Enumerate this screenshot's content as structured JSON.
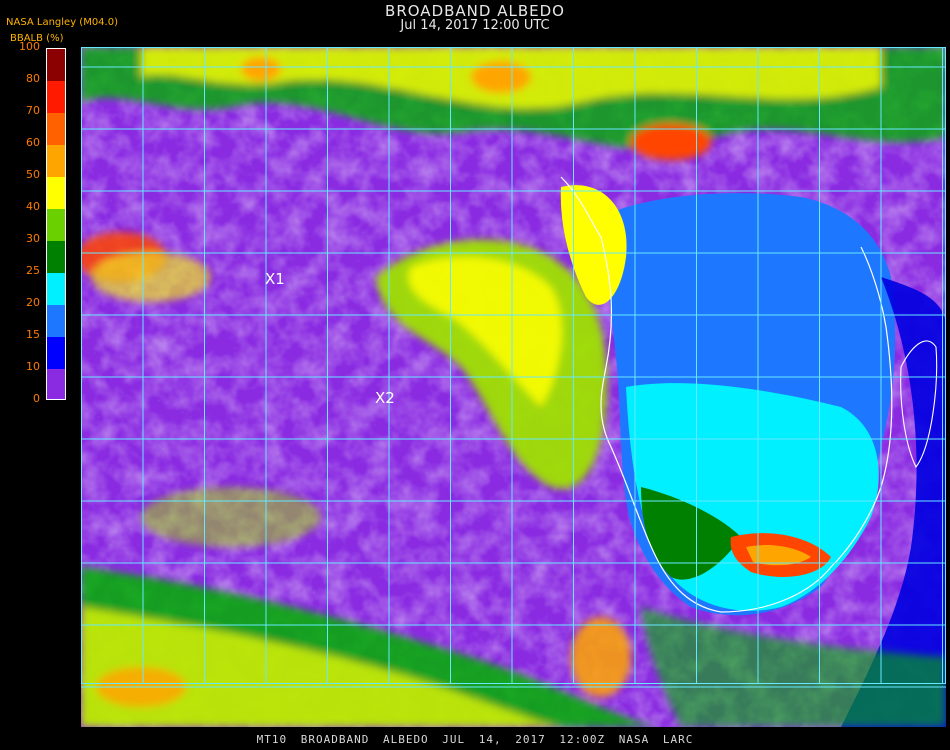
{
  "header": {
    "title": "BROADBAND ALBEDO",
    "datetime": "Jul 14, 2017 12:00 UTC",
    "source": "NASA Langley (M04.0)",
    "units_label": "BBALB (%)"
  },
  "colorbar": {
    "ticks": [
      "100",
      "80",
      "70",
      "60",
      "50",
      "40",
      "30",
      "25",
      "20",
      "15",
      "10",
      "0"
    ],
    "segments": [
      {
        "from": 0,
        "to": 10,
        "color": "#8a2be2"
      },
      {
        "from": 10,
        "to": 15,
        "color": "#0000ff"
      },
      {
        "from": 15,
        "to": 20,
        "color": "#1e78ff"
      },
      {
        "from": 20,
        "to": 25,
        "color": "#00f0ff"
      },
      {
        "from": 25,
        "to": 30,
        "color": "#008000"
      },
      {
        "from": 30,
        "to": 40,
        "color": "#6ad000"
      },
      {
        "from": 40,
        "to": 50,
        "color": "#ffff00"
      },
      {
        "from": 50,
        "to": 60,
        "color": "#ffa500"
      },
      {
        "from": 60,
        "to": 70,
        "color": "#ff6000"
      },
      {
        "from": 70,
        "to": 80,
        "color": "#ff1a00"
      },
      {
        "from": 80,
        "to": 100,
        "color": "#8b0000"
      }
    ]
  },
  "markers": [
    {
      "label": "X1"
    },
    {
      "label": "X2"
    }
  ],
  "grid_color": "#66e8ff",
  "footer": "MT10 BROADBAND ALBEDO JUL 14, 2017 12:00Z NASA LARC"
}
